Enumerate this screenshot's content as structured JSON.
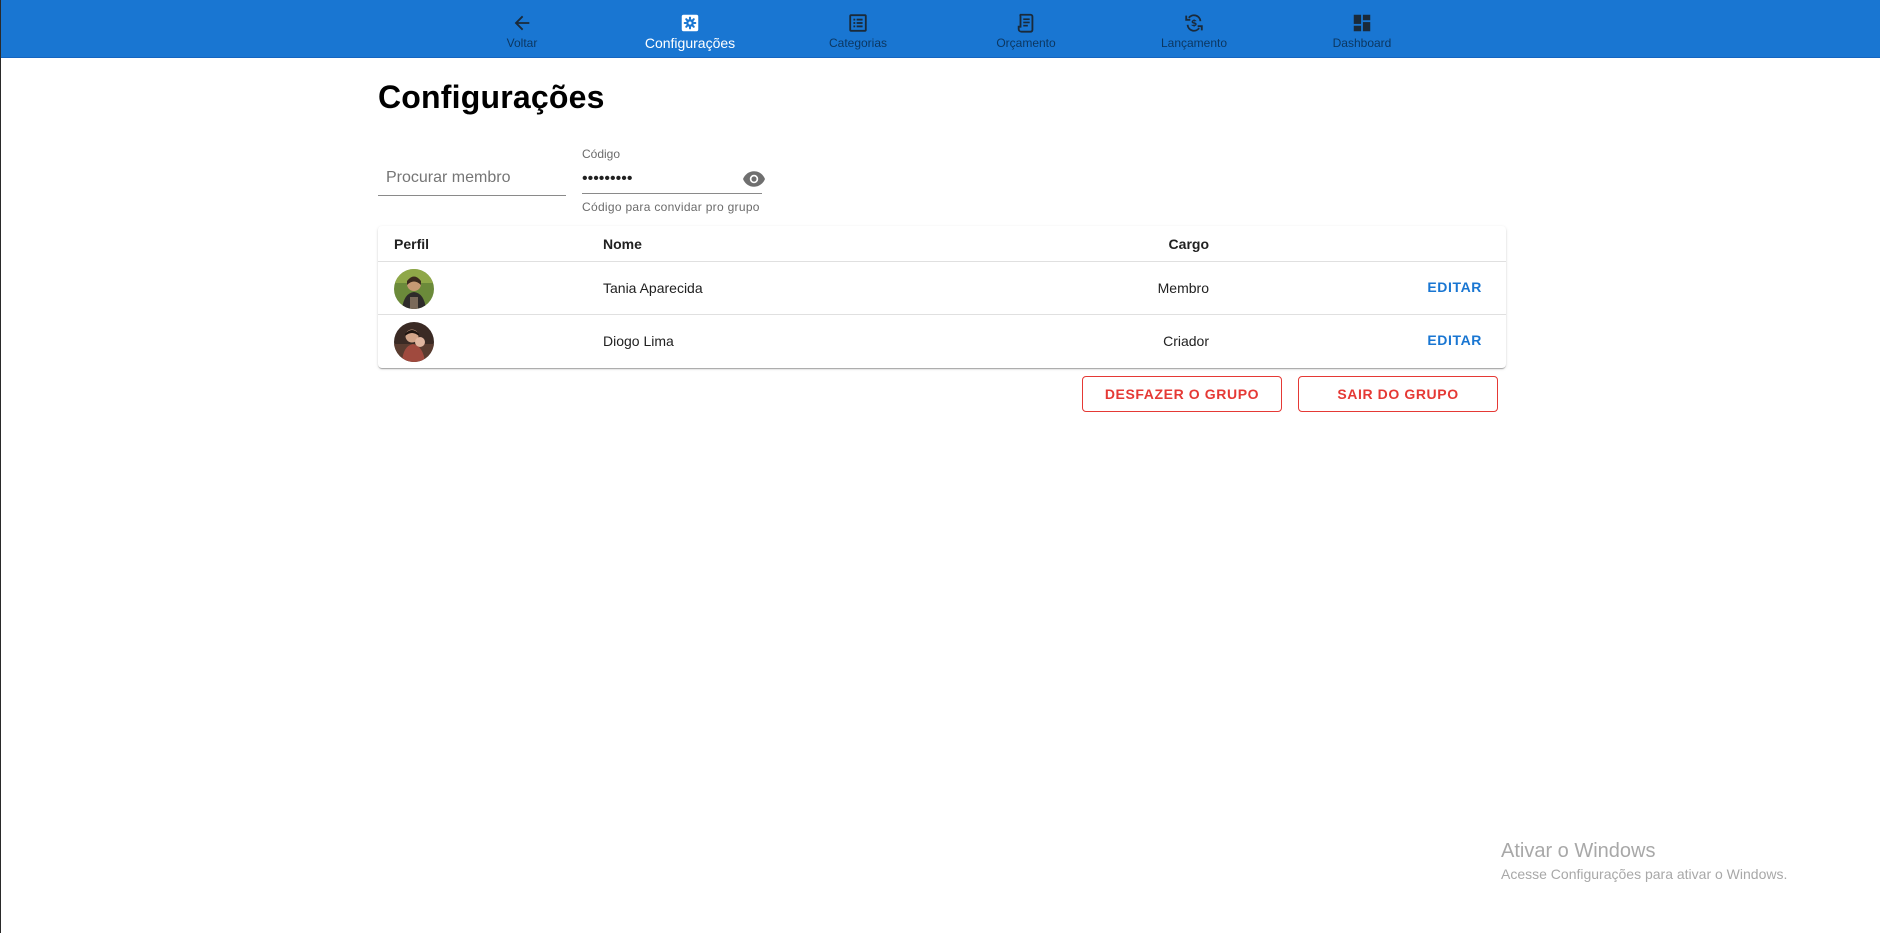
{
  "nav": {
    "items": [
      {
        "label": "Voltar",
        "icon": "arrow-left-icon"
      },
      {
        "label": "Configurações",
        "icon": "gear-icon",
        "active": true
      },
      {
        "label": "Categorias",
        "icon": "list-icon"
      },
      {
        "label": "Orçamento",
        "icon": "receipt-icon"
      },
      {
        "label": "Lançamento",
        "icon": "currency-exchange-icon"
      },
      {
        "label": "Dashboard",
        "icon": "dashboard-icon"
      }
    ],
    "colors": {
      "bar": "#1976d2",
      "inactive_text": "rgba(0,0,0,0.54)",
      "active_text": "#ffffff"
    }
  },
  "page": {
    "title": "Configurações"
  },
  "search": {
    "placeholder": "Procurar membro",
    "value": ""
  },
  "code": {
    "label": "Código",
    "value": "•••••••••",
    "helper": "Código para convidar pro grupo",
    "toggle_icon": "eye-icon"
  },
  "table": {
    "columns": {
      "profile": "Perfil",
      "name": "Nome",
      "role": "Cargo"
    },
    "rows": [
      {
        "name": "Tania Aparecida",
        "role": "Membro",
        "action": "EDITAR",
        "avatar": "avatar-photo"
      },
      {
        "name": "Diogo Lima",
        "role": "Criador",
        "action": "EDITAR",
        "avatar": "avatar-photo"
      }
    ]
  },
  "actions": {
    "disband": "DESFAZER O GRUPO",
    "leave": "SAIR DO GRUPO",
    "color": "#e53935"
  },
  "watermark": {
    "title": "Ativar o Windows",
    "subtitle": "Acesse Configurações para ativar o Windows."
  }
}
